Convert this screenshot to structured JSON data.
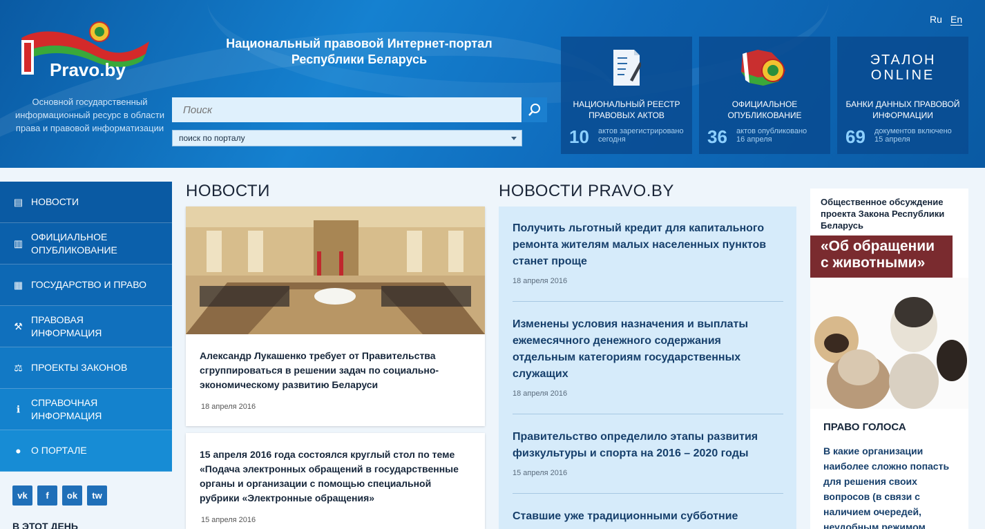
{
  "header": {
    "logo_text": "Pravo.by",
    "tagline": "Основной государственный информационный ресурс в области права и правовой информатизации",
    "portal_title_line1": "Национальный правовой Интернет-портал",
    "portal_title_line2": "Республики Беларусь",
    "search_placeholder": "Поиск",
    "search_scope": "поиск по порталу",
    "lang_ru": "Ru",
    "lang_en": "En"
  },
  "stats": [
    {
      "title": "НАЦИОНАЛЬНЫЙ РЕЕСТР ПРАВОВЫХ АКТОВ",
      "number": "10",
      "caption_line1": "актов зарегистрировано",
      "caption_line2": "сегодня",
      "icon": "registry-document-icon"
    },
    {
      "title": "ОФИЦИАЛЬНОЕ ОПУБЛИКОВАНИЕ",
      "number": "36",
      "caption_line1": "актов опубликовано",
      "caption_line2": "16 апреля",
      "icon": "belarus-map-emblem-icon"
    },
    {
      "title": "БАНКИ ДАННЫХ ПРАВОВОЙ ИНФОРМАЦИИ",
      "number": "69",
      "caption_line1": "документов включено",
      "caption_line2": "15 апреля",
      "icon": "etalon-online-logo"
    }
  ],
  "etalon": {
    "line1": "ЭТАЛОН",
    "line2": "ONLINE"
  },
  "sidenav": [
    {
      "label": "НОВОСТИ",
      "icon": "news-icon",
      "color": "#0a5aa3"
    },
    {
      "label": "ОФИЦИАЛЬНОЕ ОПУБЛИКОВАНИЕ",
      "icon": "document-icon",
      "color": "#0b60ab"
    },
    {
      "label": "ГОСУДАРСТВО И ПРАВО",
      "icon": "building-icon",
      "color": "#0d68b4"
    },
    {
      "label": "ПРАВОВАЯ ИНФОРМАЦИЯ",
      "icon": "gavel-icon",
      "color": "#1070bd"
    },
    {
      "label": "ПРОЕКТЫ ЗАКОНОВ",
      "icon": "scales-icon",
      "color": "#1279c5"
    },
    {
      "label": "СПРАВОЧНАЯ ИНФОРМАЦИЯ",
      "icon": "info-icon",
      "color": "#1482cd"
    },
    {
      "label": "О ПОРТАЛЕ",
      "icon": "chat-icon",
      "color": "#178cd5"
    }
  ],
  "social": [
    "vk",
    "f",
    "ok",
    "tw"
  ],
  "today_label": "В ЭТОТ ДЕНЬ",
  "news": {
    "section_title": "НОВОСТИ",
    "items": [
      {
        "text": "Александр Лукашенко требует от Правительства сгруппироваться в решении задач по социально-экономическому развитию Беларуси",
        "date": "18 апреля 2016"
      },
      {
        "text": "15 апреля 2016 года состоялся круглый стол по теме «Подача электронных обращений в государственные органы и организации с помощью специальной рубрики «Электронные обращения»",
        "date": "15 апреля 2016"
      }
    ]
  },
  "pravo_news": {
    "section_title": "НОВОСТИ PRAVO.BY",
    "items": [
      {
        "text": "Получить льготный кредит для капитального ремонта жителям малых населенных пунктов станет проще",
        "date": "18 апреля 2016"
      },
      {
        "text": "Изменены условия назначения и выплаты ежемесячного денежного содержания отдельным категориям государственных служащих",
        "date": "18 апреля 2016"
      },
      {
        "text": "Правительство определило этапы развития физкультуры и спорта на 2016 – 2020 годы",
        "date": "15 апреля 2016"
      },
      {
        "text": "Ставшие уже традиционными субботние",
        "date": ""
      }
    ]
  },
  "banner": {
    "title": "Общественное обсуждение проекта Закона Республики Беларусь",
    "highlight": "«Об обращении с животными»"
  },
  "golos": {
    "title": "ПРАВО ГОЛОСА",
    "question": "В какие организации наиболее сложно попасть для решения своих вопросов (в связи с наличием очередей, неудобным режимом"
  }
}
